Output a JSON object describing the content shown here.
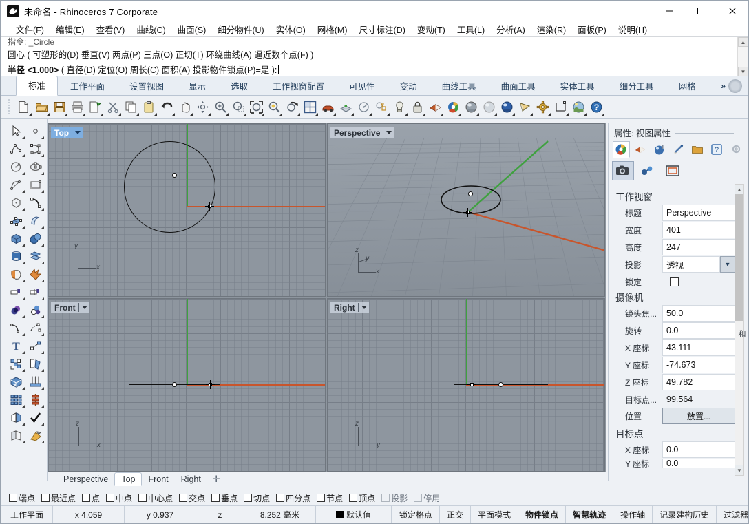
{
  "window": {
    "title": "未命名 - Rhinoceros 7 Corporate",
    "app_icon": "rhino-logo-icon",
    "minimize": "—",
    "maximize": "▢",
    "close": "✕"
  },
  "menubar": [
    {
      "label": "文件(F)"
    },
    {
      "label": "编辑(E)"
    },
    {
      "label": "查看(V)"
    },
    {
      "label": "曲线(C)"
    },
    {
      "label": "曲面(S)"
    },
    {
      "label": "细分物件(U)"
    },
    {
      "label": "实体(O)"
    },
    {
      "label": "网格(M)"
    },
    {
      "label": "尺寸标注(D)"
    },
    {
      "label": "变动(T)"
    },
    {
      "label": "工具(L)"
    },
    {
      "label": "分析(A)"
    },
    {
      "label": "渲染(R)"
    },
    {
      "label": "面板(P)"
    },
    {
      "label": "说明(H)"
    }
  ],
  "command": {
    "history": "指令: _Circle",
    "line1": "圆心 ( 可塑形的(D)  垂直(V)  两点(P)  三点(O)  正切(T)  环绕曲线(A)  逼近数个点(F) )",
    "line2_bold": "半径 <1.000>",
    "line2_rest": " ( 直径(D)  定位(O)  周长(C)  面积(A)  投影物件锁点(P)=是 ):"
  },
  "ribbon": {
    "tabs": [
      {
        "label": "标准",
        "active": true
      },
      {
        "label": "工作平面",
        "active": false
      },
      {
        "label": "设置视图",
        "active": false
      },
      {
        "label": "显示",
        "active": false
      },
      {
        "label": "选取",
        "active": false
      },
      {
        "label": "工作视窗配置",
        "active": false
      },
      {
        "label": "可见性",
        "active": false
      },
      {
        "label": "变动",
        "active": false
      },
      {
        "label": "曲线工具",
        "active": false
      },
      {
        "label": "曲面工具",
        "active": false
      },
      {
        "label": "实体工具",
        "active": false
      },
      {
        "label": "细分工具",
        "active": false
      },
      {
        "label": "网格",
        "active": false
      }
    ],
    "overflow": "»",
    "gear": "options-gear-icon"
  },
  "toolbar_icons": [
    {
      "name": "new-file-icon"
    },
    {
      "name": "open-file-icon"
    },
    {
      "name": "save-file-icon"
    },
    {
      "name": "print-icon"
    },
    {
      "name": "save-as-icon"
    },
    {
      "name": "cut-icon"
    },
    {
      "name": "copy-icon"
    },
    {
      "name": "paste-icon"
    },
    {
      "name": "undo-icon"
    },
    {
      "name": "pan-icon"
    },
    {
      "name": "rotate-view-icon"
    },
    {
      "name": "zoom-in-icon"
    },
    {
      "name": "zoom-window-icon"
    },
    {
      "name": "zoom-extents-icon"
    },
    {
      "name": "zoom-selected-icon"
    },
    {
      "name": "undo-view-icon"
    },
    {
      "name": "viewport-layout-icon"
    },
    {
      "name": "render-car-icon"
    },
    {
      "name": "grid-snap-icon"
    },
    {
      "name": "circle-radius-icon"
    },
    {
      "name": "object-properties-icon"
    },
    {
      "name": "light-bulb-icon"
    },
    {
      "name": "lock-icon"
    },
    {
      "name": "layer-icon"
    },
    {
      "name": "color-wheel-icon"
    },
    {
      "name": "shaded-sphere-icon"
    },
    {
      "name": "ghosted-sphere-icon"
    },
    {
      "name": "rendered-sphere-icon"
    },
    {
      "name": "render-preview-icon"
    },
    {
      "name": "render-settings-gear-icon"
    },
    {
      "name": "dimension-icon"
    },
    {
      "name": "environment-icon"
    },
    {
      "name": "help-icon"
    }
  ],
  "left_toolbar_icons": [
    {
      "name": "select-arrow-icon"
    },
    {
      "name": "point-icon"
    },
    {
      "name": "polyline-icon"
    },
    {
      "name": "control-point-curve-icon"
    },
    {
      "name": "circle-icon"
    },
    {
      "name": "ellipse-icon"
    },
    {
      "name": "arc-icon"
    },
    {
      "name": "rectangle-icon"
    },
    {
      "name": "polygon-icon"
    },
    {
      "name": "curve-fillet-icon"
    },
    {
      "name": "surface-from-points-icon"
    },
    {
      "name": "extrude-surface-icon"
    },
    {
      "name": "box-icon"
    },
    {
      "name": "sphere-icon"
    },
    {
      "name": "cylinder-icon"
    },
    {
      "name": "surface-edit-icon"
    },
    {
      "name": "boolean-union-icon"
    },
    {
      "name": "explode-icon"
    },
    {
      "name": "trim-icon"
    },
    {
      "name": "split-icon"
    },
    {
      "name": "boolean-difference-icon"
    },
    {
      "name": "boolean-intersect-icon"
    },
    {
      "name": "offset-curve-icon"
    },
    {
      "name": "blend-curve-icon"
    },
    {
      "name": "text-icon"
    },
    {
      "name": "scale-icon"
    },
    {
      "name": "group-icon"
    },
    {
      "name": "copy-object-icon"
    },
    {
      "name": "cplane-icon"
    },
    {
      "name": "array-linear-icon"
    },
    {
      "name": "array-grid-icon"
    },
    {
      "name": "array-polar-icon"
    },
    {
      "name": "mirror-icon"
    },
    {
      "name": "check-object-icon"
    },
    {
      "name": "fold-surface-icon"
    },
    {
      "name": "render-material-icon"
    }
  ],
  "viewports": [
    {
      "id": "top",
      "label": "Top",
      "active": true,
      "caret": "chevron-down-icon",
      "cplane_axes": [
        "y",
        "x"
      ],
      "content": "circle-and-cplane-axes"
    },
    {
      "id": "perspective",
      "label": "Perspective",
      "active": false,
      "caret": "chevron-down-icon",
      "cplane_axes": [
        "z",
        "y",
        "x"
      ],
      "content": "perspective-ellipse-and-ground-grid"
    },
    {
      "id": "front",
      "label": "Front",
      "active": false,
      "caret": "chevron-down-icon",
      "cplane_axes": [
        "z",
        "x"
      ],
      "content": "edge-on-circle-line"
    },
    {
      "id": "right",
      "label": "Right",
      "active": false,
      "caret": "chevron-down-icon",
      "cplane_axes": [
        "z",
        "y"
      ],
      "content": "edge-on-circle-line"
    }
  ],
  "viewport_tabs": [
    {
      "label": "Perspective",
      "active": false
    },
    {
      "label": "Top",
      "active": true
    },
    {
      "label": "Front",
      "active": false
    },
    {
      "label": "Right",
      "active": false
    }
  ],
  "viewport_tab_add": "✛",
  "properties": {
    "title": "属性: 视图属性",
    "tabs": [
      {
        "name": "object-properties-tab",
        "active": true
      },
      {
        "name": "layer-tab",
        "active": false
      },
      {
        "name": "material-tab",
        "active": false
      },
      {
        "name": "display-tab",
        "active": false
      },
      {
        "name": "folder-tab",
        "active": false
      },
      {
        "name": "help-tab",
        "active": false
      }
    ],
    "settings_gear": "panel-gear-icon",
    "subtabs": [
      {
        "name": "camera-subtab",
        "active": true
      },
      {
        "name": "render-subtab",
        "active": false
      },
      {
        "name": "frame-subtab",
        "active": false
      }
    ],
    "sections": [
      {
        "heading": "工作视窗",
        "rows": [
          {
            "label": "标题",
            "value": "Perspective",
            "type": "text"
          },
          {
            "label": "宽度",
            "value": "401",
            "type": "text"
          },
          {
            "label": "高度",
            "value": "247",
            "type": "text"
          },
          {
            "label": "投影",
            "value": "透视",
            "type": "dropdown"
          },
          {
            "label": "锁定",
            "value": "",
            "type": "checkbox"
          }
        ]
      },
      {
        "heading": "摄像机",
        "rows": [
          {
            "label": "镜头焦...",
            "value": "50.0",
            "type": "text"
          },
          {
            "label": "旋转",
            "value": "0.0",
            "type": "text"
          },
          {
            "label": "X 座标",
            "value": "43.111",
            "type": "text"
          },
          {
            "label": "Y 座标",
            "value": "-74.673",
            "type": "text"
          },
          {
            "label": "Z 座标",
            "value": "49.782",
            "type": "text"
          },
          {
            "label": "目标点...",
            "value": "99.564",
            "type": "plain"
          },
          {
            "label": "位置",
            "value": "放置...",
            "type": "button"
          }
        ]
      },
      {
        "heading": "目标点",
        "rows": [
          {
            "label": "X 座标",
            "value": "0.0",
            "type": "text"
          },
          {
            "label": "Y 座标",
            "value": "0.0",
            "type": "text"
          }
        ]
      }
    ],
    "side_label": "和"
  },
  "osnap": {
    "items": [
      {
        "label": "端点",
        "checked": false,
        "enabled": true
      },
      {
        "label": "最近点",
        "checked": false,
        "enabled": true
      },
      {
        "label": "点",
        "checked": false,
        "enabled": true
      },
      {
        "label": "中点",
        "checked": false,
        "enabled": true
      },
      {
        "label": "中心点",
        "checked": false,
        "enabled": true
      },
      {
        "label": "交点",
        "checked": false,
        "enabled": true
      },
      {
        "label": "垂点",
        "checked": false,
        "enabled": true
      },
      {
        "label": "切点",
        "checked": false,
        "enabled": true
      },
      {
        "label": "四分点",
        "checked": false,
        "enabled": true
      },
      {
        "label": "节点",
        "checked": false,
        "enabled": true
      },
      {
        "label": "顶点",
        "checked": false,
        "enabled": true
      },
      {
        "label": "投影",
        "checked": false,
        "enabled": false
      },
      {
        "label": "停用",
        "checked": false,
        "enabled": false
      }
    ]
  },
  "statusbar": {
    "left": [
      {
        "label": "工作平面"
      },
      {
        "label": "x 4.059"
      },
      {
        "label": "y 0.937"
      },
      {
        "label": "z"
      },
      {
        "label": "8.252 毫米"
      }
    ],
    "layer_swatch": "#000000",
    "layer_label": "默认值",
    "right": [
      {
        "label": "锁定格点",
        "bold": false
      },
      {
        "label": "正交",
        "bold": false
      },
      {
        "label": "平面模式",
        "bold": false
      },
      {
        "label": "物件锁点",
        "bold": true
      },
      {
        "label": "智慧轨迹",
        "bold": true
      },
      {
        "label": "操作轴",
        "bold": false
      },
      {
        "label": "记录建构历史",
        "bold": false
      },
      {
        "label": "过滤器",
        "bold": false
      },
      {
        "label": "(",
        "bold": false
      }
    ]
  },
  "colors": {
    "accent": "#7eaee0",
    "axis_x": "#c8552c",
    "axis_y": "#3fa13f",
    "viewport_bg": "#8e969f",
    "panel_bg": "#eef1f5"
  }
}
